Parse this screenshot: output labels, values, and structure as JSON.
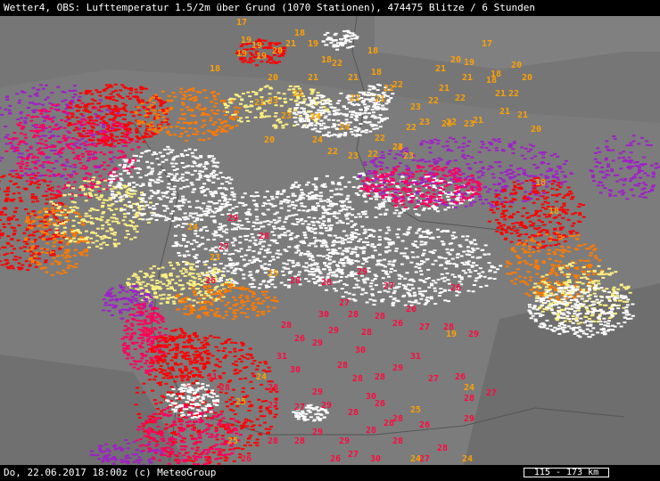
{
  "header": {
    "title": "Wetter4, OBS: Lufttemperatur 1.5/2m über Grund (1070 Stationen), 474475 Blitze / 6 Stunden"
  },
  "footer": {
    "timestamp": "Do, 22.06.2017 18:00z (c) MeteoGroup",
    "scale": "115 - 173 km"
  },
  "map": {
    "legend_colors": {
      "oldest_strikes": "#a020c8",
      "older_strikes": "#ff0060",
      "mid_strikes": "#ff0000",
      "recent_strikes": "#ff7a00",
      "newer_strikes": "#fff080",
      "newest_strikes": "#ffffff",
      "label_warm": "#ffa000",
      "label_hot": "#ff0a3c",
      "background": "#7c7c7c"
    },
    "temperature_labels": [
      {
        "value": "17"
      },
      {
        "value": "18"
      },
      {
        "value": "19"
      },
      {
        "value": "20"
      },
      {
        "value": "21"
      },
      {
        "value": "19"
      },
      {
        "value": "18"
      },
      {
        "value": "18"
      },
      {
        "value": "17"
      },
      {
        "value": "19"
      },
      {
        "value": "18"
      },
      {
        "value": "20"
      },
      {
        "value": "21"
      },
      {
        "value": "22"
      },
      {
        "value": "21"
      },
      {
        "value": "20"
      },
      {
        "value": "21"
      },
      {
        "value": "22"
      },
      {
        "value": "21"
      },
      {
        "value": "22"
      },
      {
        "value": "22"
      },
      {
        "value": "22"
      },
      {
        "value": "23"
      },
      {
        "value": "23"
      },
      {
        "value": "22"
      },
      {
        "value": "23"
      },
      {
        "value": "24"
      },
      {
        "value": "23"
      },
      {
        "value": "22"
      },
      {
        "value": "21"
      },
      {
        "value": "21"
      },
      {
        "value": "20"
      },
      {
        "value": "19"
      },
      {
        "value": "18"
      },
      {
        "value": "19"
      },
      {
        "value": "18"
      },
      {
        "value": "21"
      },
      {
        "value": "22"
      },
      {
        "value": "21"
      },
      {
        "value": "20"
      },
      {
        "value": "21"
      },
      {
        "value": "22"
      },
      {
        "value": "24"
      },
      {
        "value": "22"
      },
      {
        "value": "23"
      },
      {
        "value": "23"
      },
      {
        "value": "22"
      },
      {
        "value": "24"
      },
      {
        "value": "23"
      },
      {
        "value": "24"
      },
      {
        "value": "20"
      },
      {
        "value": "21"
      },
      {
        "value": "23"
      },
      {
        "value": "22"
      },
      {
        "value": "21"
      },
      {
        "value": "19"
      },
      {
        "value": "18"
      },
      {
        "value": "20"
      },
      {
        "value": "22"
      },
      {
        "value": "23"
      },
      {
        "value": "28"
      },
      {
        "value": "26"
      },
      {
        "value": "29"
      },
      {
        "value": "30"
      },
      {
        "value": "31"
      },
      {
        "value": "33"
      },
      {
        "value": "28"
      },
      {
        "value": "29"
      },
      {
        "value": "27"
      },
      {
        "value": "26"
      },
      {
        "value": "28"
      },
      {
        "value": "28"
      },
      {
        "value": "29"
      },
      {
        "value": "31"
      },
      {
        "value": "30"
      },
      {
        "value": "28"
      },
      {
        "value": "27"
      },
      {
        "value": "29"
      },
      {
        "value": "28"
      },
      {
        "value": "26"
      },
      {
        "value": "25"
      },
      {
        "value": "24"
      },
      {
        "value": "26"
      },
      {
        "value": "28"
      },
      {
        "value": "28"
      },
      {
        "value": "29"
      },
      {
        "value": "29"
      },
      {
        "value": "28"
      },
      {
        "value": "26"
      },
      {
        "value": "25"
      },
      {
        "value": "27"
      },
      {
        "value": "28"
      },
      {
        "value": "24"
      },
      {
        "value": "30"
      },
      {
        "value": "31"
      },
      {
        "value": "28"
      },
      {
        "value": "29"
      },
      {
        "value": "28"
      },
      {
        "value": "26"
      },
      {
        "value": "27"
      },
      {
        "value": "28"
      },
      {
        "value": "29"
      },
      {
        "value": "30"
      },
      {
        "value": "28"
      },
      {
        "value": "27"
      },
      {
        "value": "28"
      },
      {
        "value": "26"
      },
      {
        "value": "24"
      },
      {
        "value": "25"
      },
      {
        "value": "27"
      },
      {
        "value": "28"
      },
      {
        "value": "26"
      },
      {
        "value": "27"
      },
      {
        "value": "28"
      },
      {
        "value": "29"
      },
      {
        "value": "30"
      },
      {
        "value": "28"
      },
      {
        "value": "26"
      },
      {
        "value": "29"
      },
      {
        "value": "24"
      },
      {
        "value": "27"
      },
      {
        "value": "25"
      },
      {
        "value": "28"
      },
      {
        "value": "28"
      },
      {
        "value": "29"
      },
      {
        "value": "27"
      },
      {
        "value": "26"
      },
      {
        "value": "28"
      },
      {
        "value": "27"
      },
      {
        "value": "24"
      },
      {
        "value": "18"
      },
      {
        "value": "28"
      },
      {
        "value": "23"
      },
      {
        "value": "18"
      },
      {
        "value": "19"
      }
    ]
  }
}
